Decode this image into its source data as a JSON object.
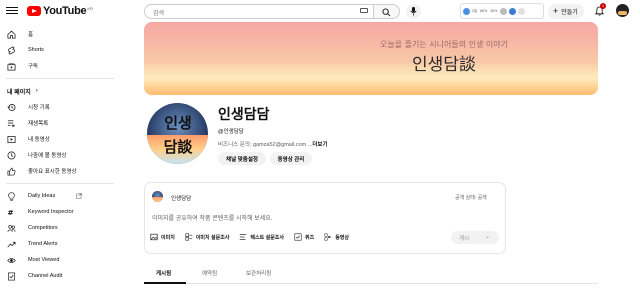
{
  "header": {
    "logo_text": "YouTube",
    "logo_region": "KR",
    "search_placeholder": "검색",
    "create_label": "만들기",
    "notification_count": "1",
    "extension_stats": [
      "2일",
      "86%",
      "45%"
    ]
  },
  "sidebar": {
    "top_items": [
      {
        "label": "홈",
        "icon": "home-icon"
      },
      {
        "label": "Shorts",
        "icon": "shorts-icon"
      },
      {
        "label": "구독",
        "icon": "subscriptions-icon"
      }
    ],
    "section_title": "내 페이지",
    "section_chevron": "›",
    "my_items": [
      {
        "label": "시청 기록",
        "icon": "history-icon"
      },
      {
        "label": "재생목록",
        "icon": "playlist-icon"
      },
      {
        "label": "내 동영상",
        "icon": "my-videos-icon"
      },
      {
        "label": "나중에 볼 동영상",
        "icon": "watch-later-icon"
      },
      {
        "label": "좋아요 표시한 동영상",
        "icon": "liked-icon"
      }
    ],
    "ext_items": [
      {
        "label": "Daily Ideas",
        "icon": "lightbulb-icon"
      },
      {
        "label": "Keyword Inspector",
        "icon": "keyword-icon"
      },
      {
        "label": "Competitors",
        "icon": "competitors-icon"
      },
      {
        "label": "Trend Alerts",
        "icon": "trend-icon"
      },
      {
        "label": "Most Viewed",
        "icon": "most-viewed-icon"
      },
      {
        "label": "Channel Audit",
        "icon": "audit-icon"
      }
    ]
  },
  "banner": {
    "subtitle": "오늘을 즐기는 시니어들의 인생 이야기",
    "title": "인생담談"
  },
  "channel": {
    "avatar_line1": "인생",
    "avatar_line2": "담談",
    "name": "인생담담",
    "handle": "@인생담담",
    "contact_prefix": "비즈니스 문의: gamza52@gmail.com ...",
    "contact_more": "더보기",
    "customize_label": "채널 맞춤설정",
    "manage_label": "동영상 관리"
  },
  "composer": {
    "name": "인생담담",
    "visibility": "공개 상태:  공개",
    "placeholder": "이미지를 공유하여 작품 콘텐츠를 시작해 보세요.",
    "tools": [
      {
        "label": "이미지",
        "icon": "image-icon"
      },
      {
        "label": "이미지 설문조사",
        "icon": "image-poll-icon"
      },
      {
        "label": "텍스트 설문조사",
        "icon": "text-poll-icon"
      },
      {
        "label": "퀴즈",
        "icon": "quiz-icon"
      },
      {
        "label": "동영상",
        "icon": "video-icon"
      }
    ],
    "post_label": "게시"
  },
  "tabs": [
    {
      "label": "게시됨",
      "active": true
    },
    {
      "label": "예약됨",
      "active": false
    },
    {
      "label": "보관처리됨",
      "active": false
    }
  ]
}
